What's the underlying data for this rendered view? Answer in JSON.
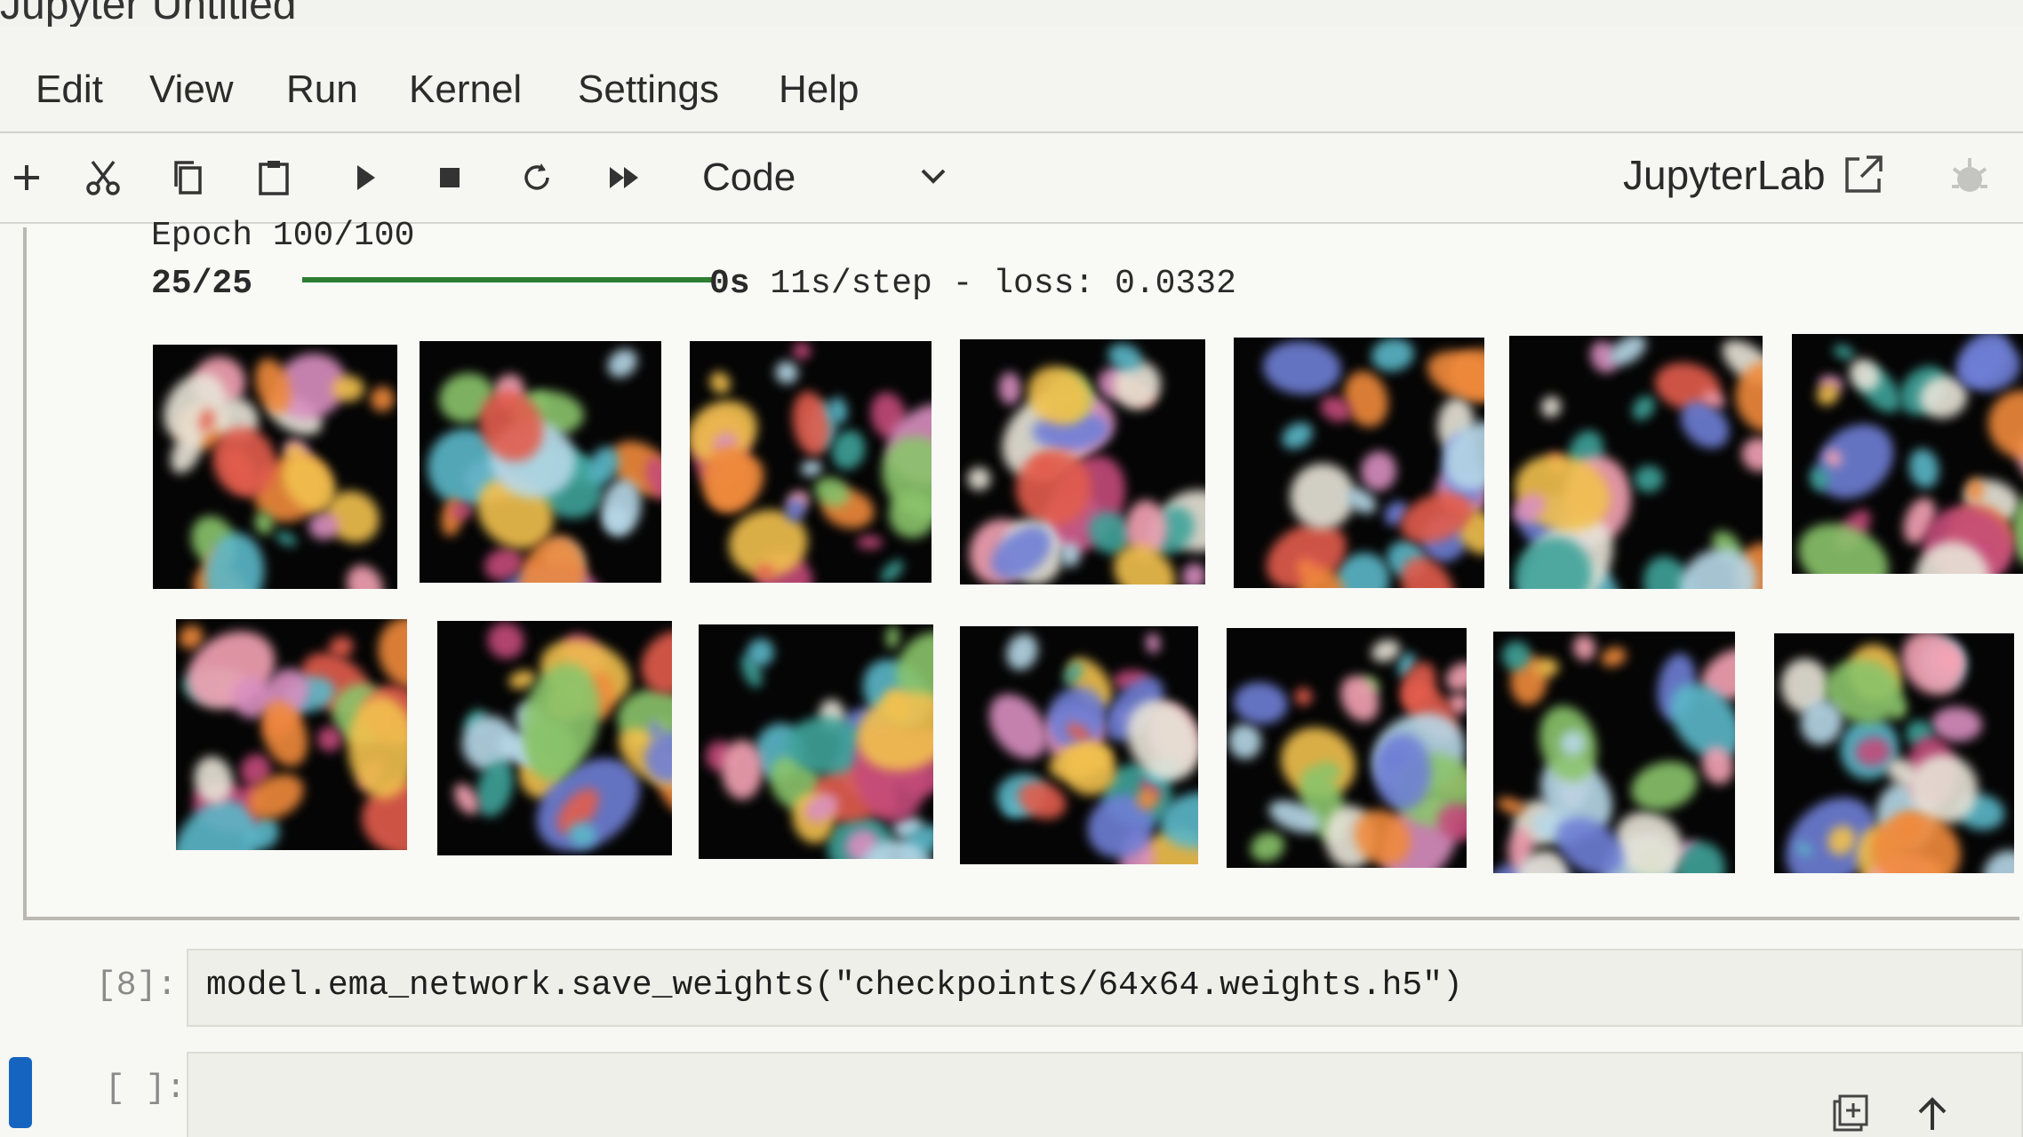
{
  "titlebar": {
    "title": "Jupyter Untitled"
  },
  "menu": [
    "Edit",
    "View",
    "Run",
    "Kernel",
    "Settings",
    "Help"
  ],
  "toolbar": {
    "icons": [
      "plus-icon",
      "scissors-icon",
      "copy-icon",
      "paste-icon",
      "play-icon",
      "stop-icon",
      "restart-icon",
      "fast-forward-icon"
    ],
    "cell_type": "Code",
    "jupyterlab_label": "JupyterLab"
  },
  "output": {
    "epoch_line": "Epoch 100/100",
    "progress_label": "25/25",
    "progress_fraction": 1.0,
    "progress_suffix_bold": "0s",
    "progress_suffix": " 11s/step - loss: 0.0332",
    "image_rows": 2,
    "images_per_row_visible": 7
  },
  "cells": [
    {
      "prompt": "[8]:",
      "code": "model.ema_network.save_weights(\"checkpoints/64x64.weights.h5\")"
    },
    {
      "prompt": "[ ]:",
      "code": ""
    }
  ],
  "colors": {
    "progress": "#2e7d32",
    "active_cell_bar": "#1565c0"
  }
}
